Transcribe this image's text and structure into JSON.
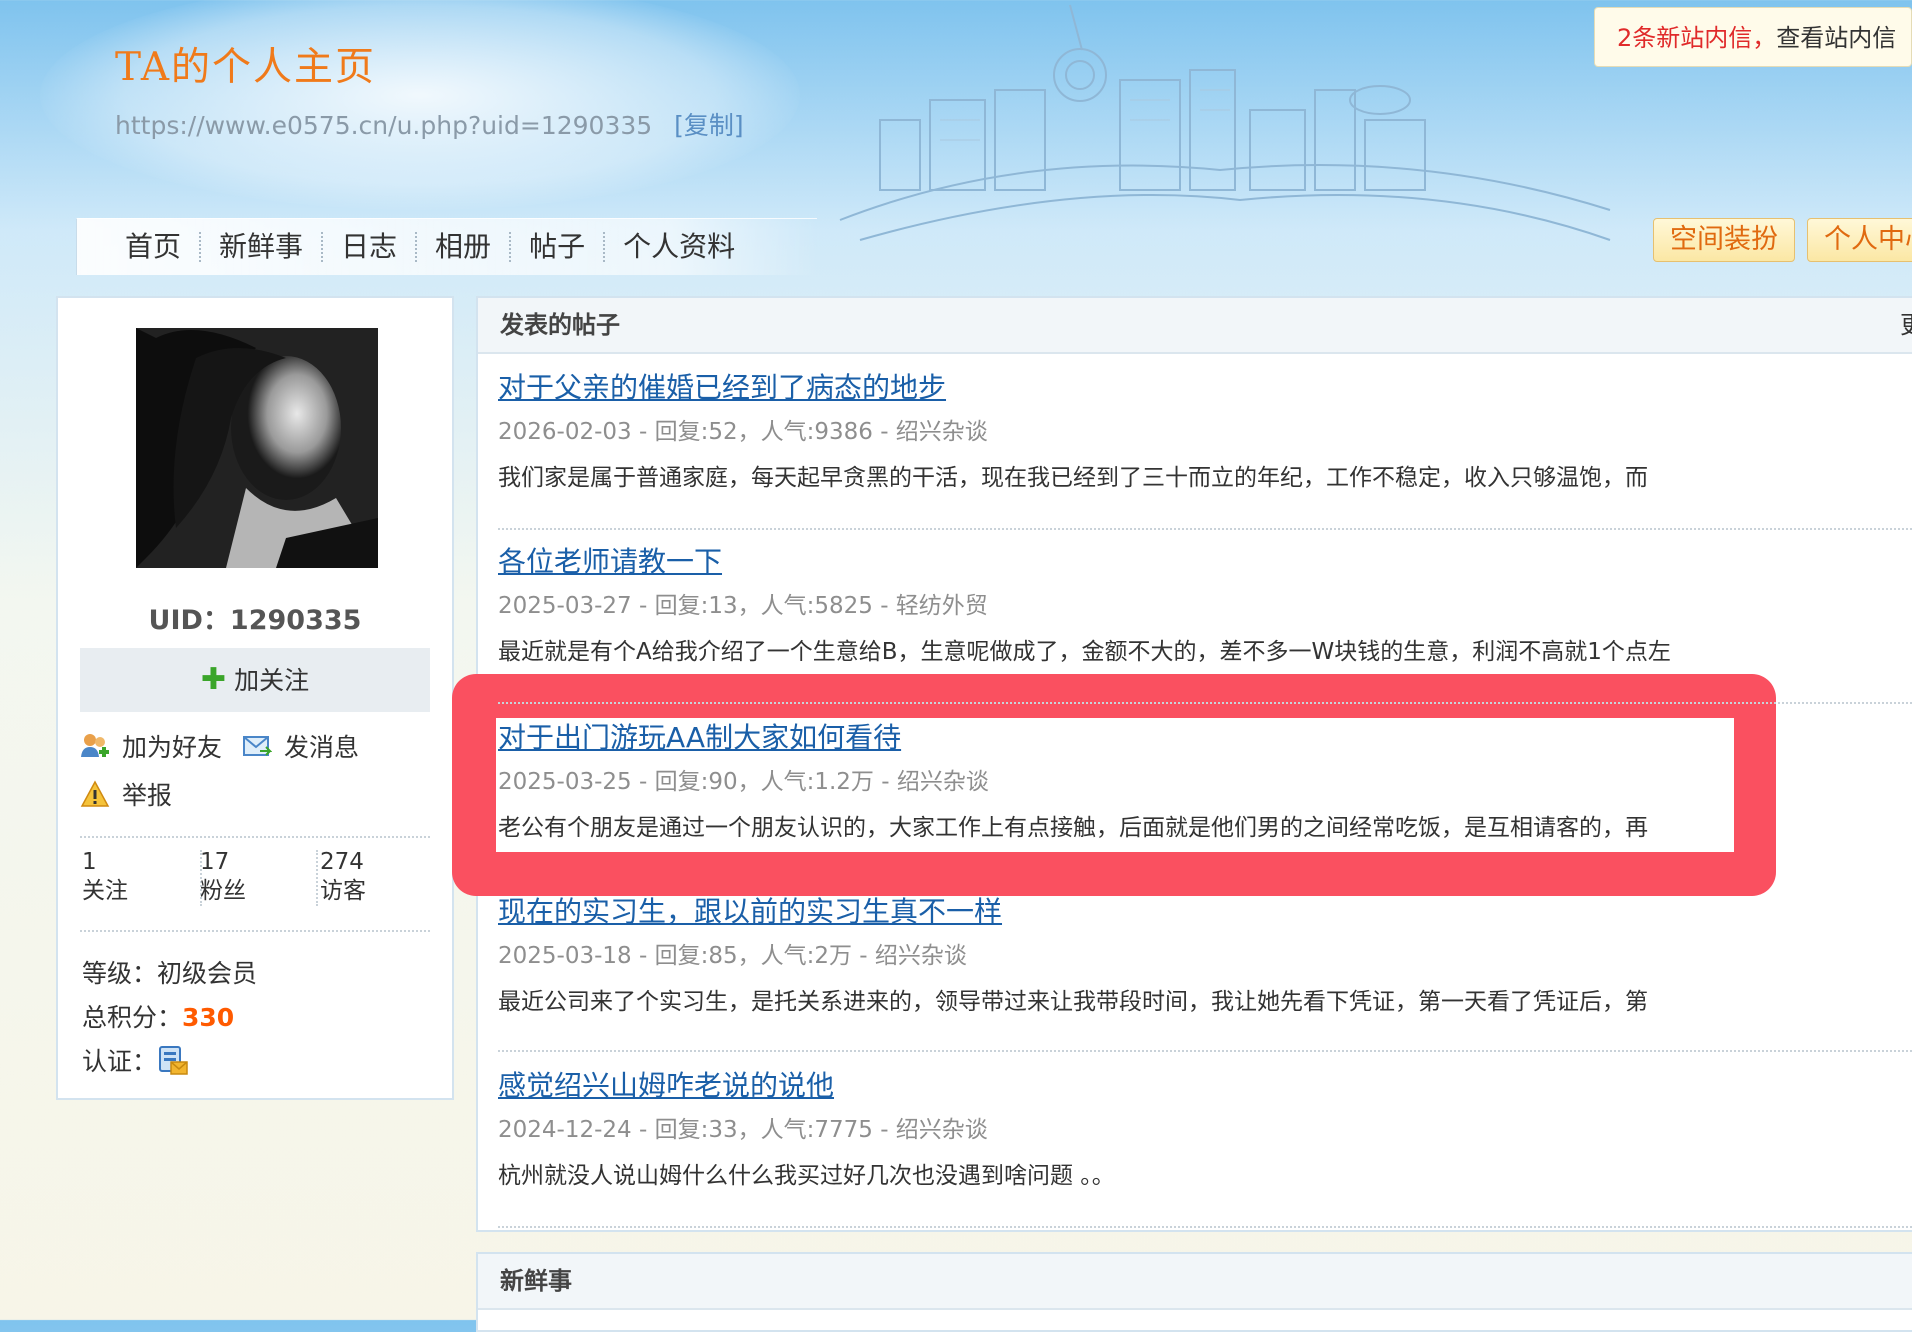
{
  "header": {
    "site_title": "TA的个人主页",
    "home_url": "https://www.e0575.cn/u.php?uid=1290335",
    "copy_label": "[复制]",
    "messages_count_label": "2条新站内信，",
    "messages_view_label": "查看站内信",
    "decorate_label": "空间装扮",
    "center_label": "个人中心"
  },
  "nav": {
    "items": [
      "首页",
      "新鲜事",
      "日志",
      "相册",
      "帖子",
      "个人资料"
    ]
  },
  "profile": {
    "uid_label": "UID：1290335",
    "follow_label": "加关注",
    "add_friend_label": "加为好友",
    "send_message_label": "发消息",
    "report_label": "举报",
    "stats": [
      {
        "value": "1",
        "label": "关注"
      },
      {
        "value": "17",
        "label": "粉丝"
      },
      {
        "value": "274",
        "label": "访客"
      }
    ],
    "level_label": "等级：",
    "level_value": "初级会员",
    "score_label": "总积分：",
    "score_value": "330",
    "cert_label": "认证："
  },
  "posts": {
    "heading": "发表的帖子",
    "more_label": "更",
    "items": [
      {
        "title": "对于父亲的催婚已经到了病态的地步",
        "meta": "2026-02-03 - 回复:52，人气:9386 - 绍兴杂谈",
        "summary": "我们家是属于普通家庭，每天起早贪黑的干活，现在我已经到了三十而立的年纪，工作不稳定，收入只够温饱，而"
      },
      {
        "title": "各位老师请教一下",
        "meta": "2025-03-27 - 回复:13，人气:5825 - 轻纺外贸",
        "summary": "最近就是有个A给我介绍了一个生意给B，生意呢做成了，金额不大的，差不多一W块钱的生意，利润不高就1个点左"
      },
      {
        "title": "对于出门游玩AA制大家如何看待",
        "meta": "2025-03-25 - 回复:90，人气:1.2万 - 绍兴杂谈",
        "summary": "老公有个朋友是通过一个朋友认识的，大家工作上有点接触，后面就是他们男的之间经常吃饭，是互相请客的，再"
      },
      {
        "title": "现在的实习生，跟以前的实习生真不一样",
        "meta": "2025-03-18 - 回复:85，人气:2万 - 绍兴杂谈",
        "summary": "最近公司来了个实习生，是托关系进来的，领导带过来让我带段时间，我让她先看下凭证，第一天看了凭证后，第"
      },
      {
        "title": "感觉绍兴山姆咋老说的说他",
        "meta": "2024-12-24 - 回复:33，人气:7775 - 绍兴杂谈",
        "summary": "杭州就没人说山姆什么什么我买过好几次也没遇到啥问题 。。"
      }
    ]
  },
  "news": {
    "heading": "新鲜事"
  },
  "colors": {
    "title_orange": "#f07a1a",
    "link_blue": "#1a5fa8",
    "highlight_red": "#fa5060",
    "score_orange": "#ff5a00"
  },
  "icons": [
    "plus-icon",
    "add-friend-icon",
    "message-icon",
    "warning-icon",
    "certification-icon"
  ]
}
